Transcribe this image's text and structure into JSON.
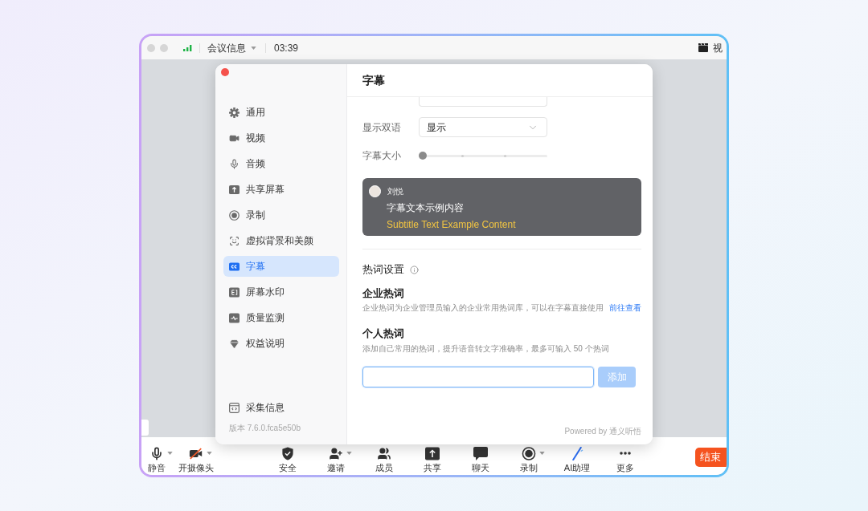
{
  "window": {
    "title_bar": {
      "meeting_info": "会议信息",
      "timer": "03:39",
      "view_label": "视"
    }
  },
  "settings_dialog": {
    "sidebar": {
      "items": [
        {
          "label": "通用",
          "selected": false
        },
        {
          "label": "视频",
          "selected": false
        },
        {
          "label": "音频",
          "selected": false
        },
        {
          "label": "共享屏幕",
          "selected": false
        },
        {
          "label": "录制",
          "selected": false
        },
        {
          "label": "虚拟背景和美颜",
          "selected": false
        },
        {
          "label": "字幕",
          "selected": true
        },
        {
          "label": "屏幕水印",
          "selected": false
        },
        {
          "label": "质量监测",
          "selected": false
        },
        {
          "label": "权益说明",
          "selected": false
        }
      ],
      "footer_item": "采集信息",
      "version": "版本 7.6.0.fca5e50b"
    },
    "panel": {
      "title": "字幕",
      "bilingual": {
        "label": "显示双语",
        "value": "显示"
      },
      "font_size": {
        "label": "字幕大小",
        "level": 0
      },
      "preview": {
        "speaker": "刘悦",
        "text": "字幕文本示例内容",
        "translation": "Subtitle Text Example Content"
      },
      "hotwords": {
        "title": "热词设置",
        "enterprise": {
          "title": "企业热词",
          "description": "企业热词为企业管理员输入的企业常用热词库，可以在字幕直接使用",
          "link": "前往查看"
        },
        "personal": {
          "title": "个人热词",
          "description": "添加自己常用的热词，提升语音转文字准确率，最多可输入 50 个热词",
          "input": {
            "focused": true
          },
          "add_button": {
            "label": "添加",
            "disabled": true
          }
        }
      },
      "powered_by": "Powered by 通义听悟"
    }
  },
  "toolbar": {
    "items": [
      {
        "label": "静音",
        "dropdown": true
      },
      {
        "label": "开摄像头",
        "dropdown": true
      },
      {
        "label": "安全",
        "dropdown": false
      },
      {
        "label": "邀请",
        "dropdown": true
      },
      {
        "label": "成员",
        "dropdown": false
      },
      {
        "label": "共享",
        "dropdown": false
      },
      {
        "label": "聊天",
        "dropdown": false
      },
      {
        "label": "录制",
        "dropdown": true
      },
      {
        "label": "AI助理",
        "dropdown": false
      },
      {
        "label": "更多",
        "dropdown": false
      }
    ],
    "end_button": "结束"
  }
}
